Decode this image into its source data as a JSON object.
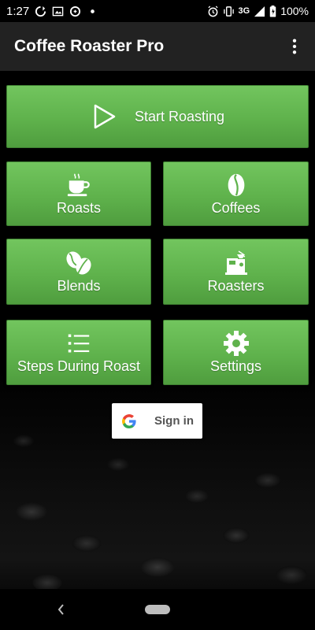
{
  "status_bar": {
    "time": "1:27",
    "network": "3G",
    "battery": "100%",
    "left_icons": [
      "sync-icon",
      "screenshot-icon",
      "data-saver-icon",
      "dot-icon"
    ],
    "right_icons": [
      "alarm-icon",
      "vibrate-icon",
      "signal-icon",
      "battery-icon"
    ]
  },
  "app_bar": {
    "title": "Coffee Roaster Pro",
    "menu_icon": "overflow-menu-icon"
  },
  "buttons": {
    "start": {
      "label": "Start Roasting",
      "icon": "play-icon"
    },
    "roasts": {
      "label": "Roasts",
      "icon": "coffee-cup-icon"
    },
    "coffees": {
      "label": "Coffees",
      "icon": "coffee-bean-icon"
    },
    "blends": {
      "label": "Blends",
      "icon": "coffee-beans-icon"
    },
    "roasters": {
      "label": "Roasters",
      "icon": "roaster-machine-icon"
    },
    "steps": {
      "label": "Steps During Roast",
      "icon": "checklist-icon"
    },
    "settings": {
      "label": "Settings",
      "icon": "gear-icon"
    }
  },
  "sign_in": {
    "label": "Sign in",
    "icon": "google-icon"
  },
  "colors": {
    "tile_green": "#5fb24c",
    "app_bar": "#222222",
    "background": "#000000"
  },
  "nav_bar": {
    "icons": [
      "back-icon",
      "home-pill-icon"
    ]
  }
}
